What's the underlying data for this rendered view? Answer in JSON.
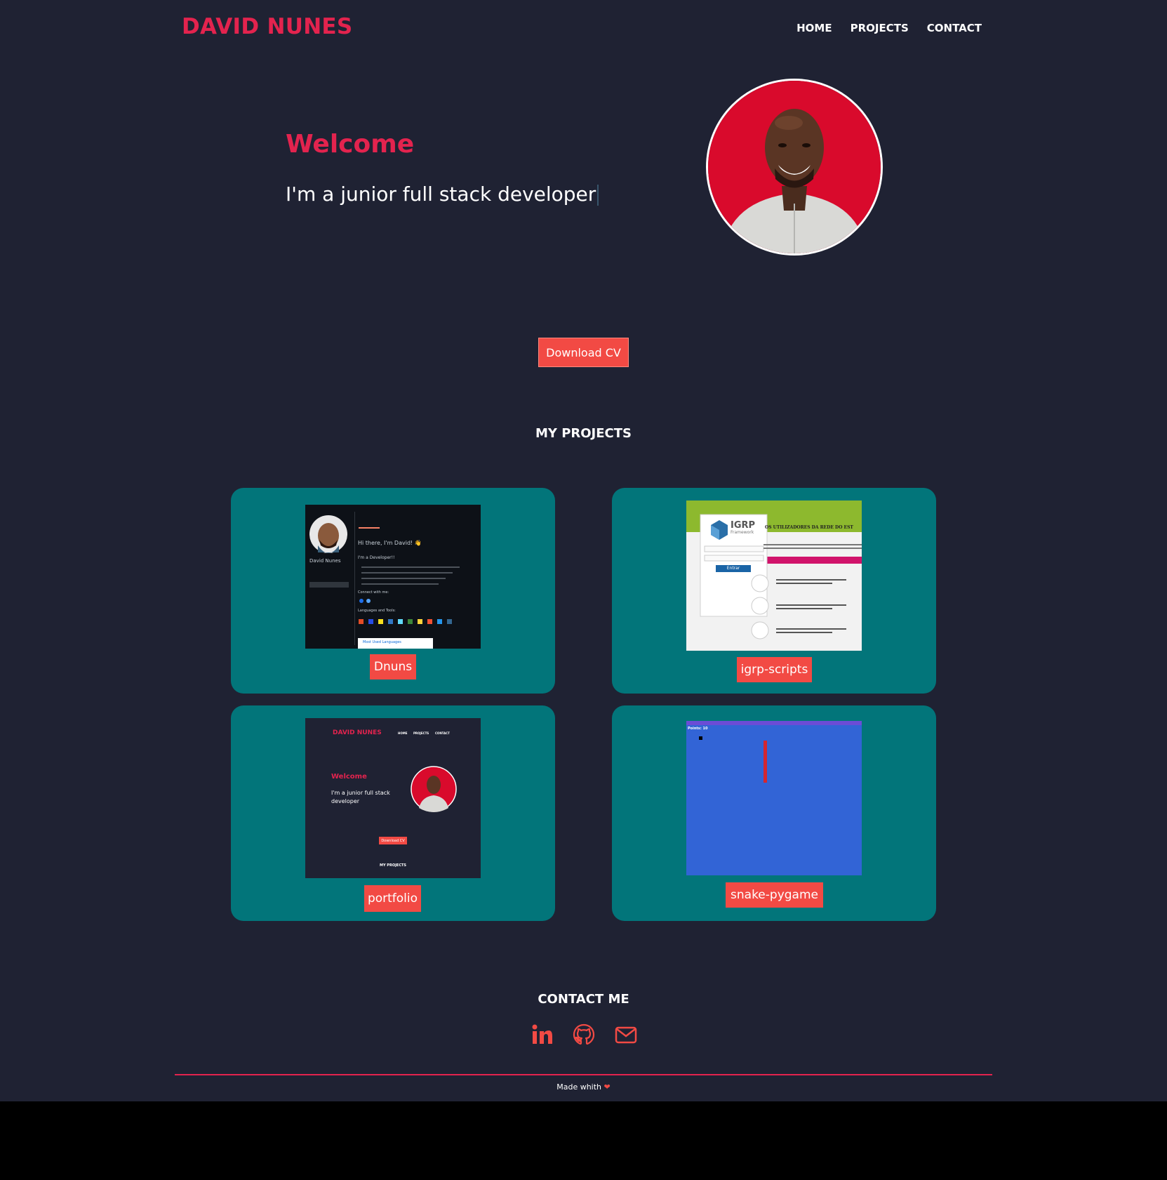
{
  "header": {
    "logo": "DAVID NUNES",
    "nav": [
      "HOME",
      "PROJECTS",
      "CONTACT"
    ]
  },
  "hero": {
    "welcome": "Welcome",
    "tagline": "I'm a junior full stack developer",
    "download_label": "Download CV"
  },
  "projects": {
    "title": "MY PROJECTS",
    "items": [
      {
        "label": "Dnuns"
      },
      {
        "label": "igrp-scripts"
      },
      {
        "label": "portfolio"
      },
      {
        "label": "snake-pygame"
      }
    ],
    "thumb_text": {
      "dnuns_greeting": "Hi there, I'm David! 👋",
      "dnuns_name": "David Nunes",
      "dnuns_sub": "I'm a Developer!!",
      "dnuns_connect": "Connect with me:",
      "dnuns_langs": "Languages and Tools:",
      "dnuns_most": "Most Used Languages",
      "igrp_logo": "IGRP",
      "igrp_sub": "Framework",
      "igrp_heading": "OS UTILIZADORES DA REDE DO EST",
      "igrp_login": "Entrar",
      "pf_logo": "DAVID NUNES",
      "pf_nav": [
        "HOME",
        "PROJECTS",
        "CONTACT"
      ],
      "pf_welcome": "Welcome",
      "pf_tagline": "I'm a junior full stack developer",
      "pf_btn": "Download CV",
      "pf_projects": "MY PROJECTS",
      "snake_score": "Points: 10"
    }
  },
  "contact": {
    "title": "CONTACT ME",
    "icons": [
      "linkedin-icon",
      "github-icon",
      "envelope-icon"
    ]
  },
  "footer": {
    "text": "Made whith",
    "heart": "❤"
  },
  "colors": {
    "background": "#1f2233",
    "accent": "#e3234e",
    "button": "#f24a44",
    "card": "#02757a"
  }
}
